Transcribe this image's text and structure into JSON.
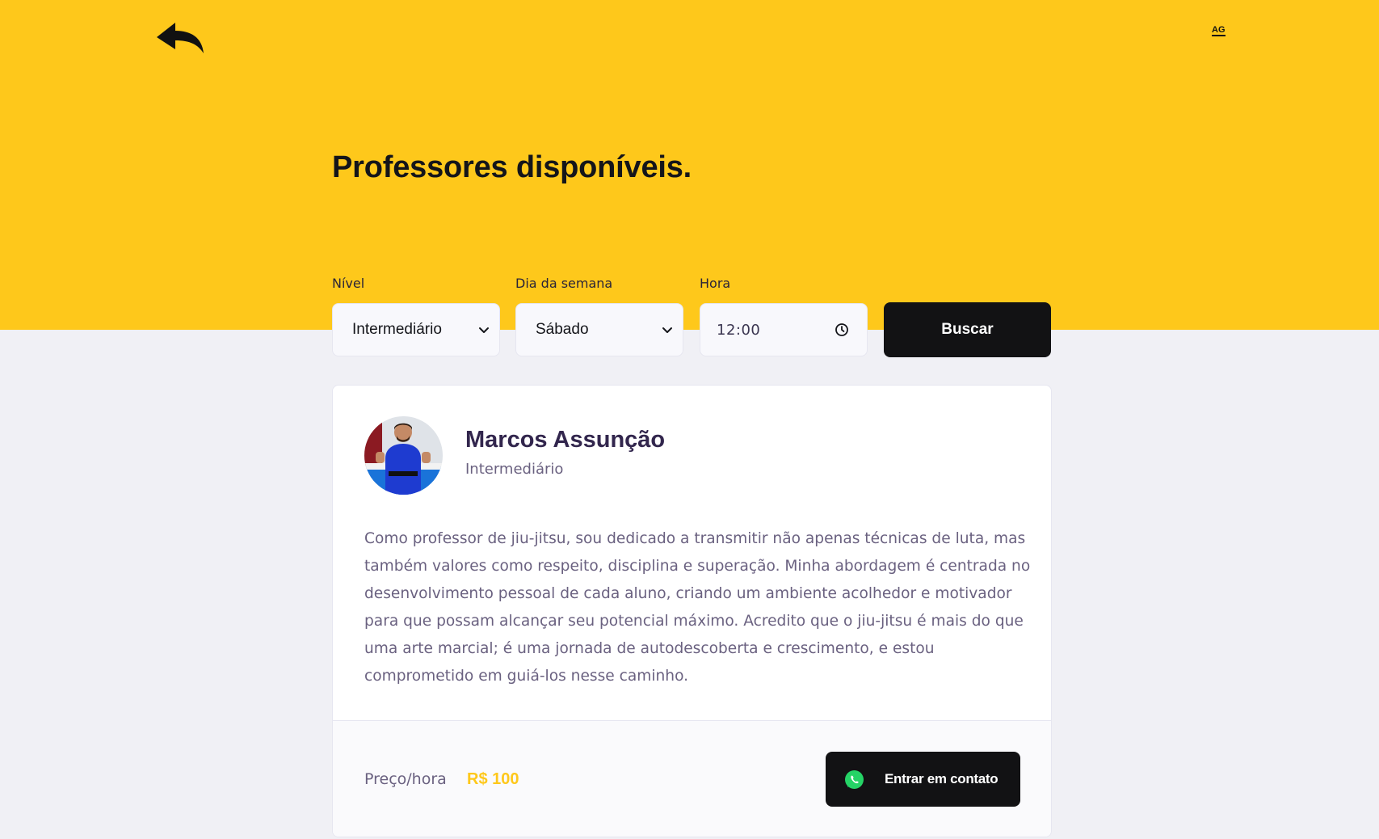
{
  "header": {
    "back_icon": "back-arrow-icon",
    "logo_text": "AG",
    "title": "Professores disponíveis."
  },
  "filters": {
    "level": {
      "label": "Nível",
      "value": "Intermediário"
    },
    "weekday": {
      "label": "Dia da semana",
      "value": "Sábado"
    },
    "time": {
      "label": "Hora",
      "value": "12:00"
    },
    "search_label": "Buscar"
  },
  "teacher": {
    "name": "Marcos Assunção",
    "level": "Intermediário",
    "bio": "Como professor de jiu-jitsu, sou dedicado a transmitir não apenas técnicas de luta, mas também valores como respeito, disciplina e superação. Minha abordagem é centrada no desenvolvimento pessoal de cada aluno, criando um ambiente acolhedor e motivador para que possam alcançar seu potencial máximo. Acredito que o jiu-jitsu é mais do que uma arte marcial; é uma jornada de autodescoberta e crescimento, e estou comprometido em guiá-los nesse caminho.",
    "price_label": "Preço/hora",
    "price_value": "R$ 100",
    "contact_label": "Entrar em contato"
  },
  "colors": {
    "accent": "#fec81b",
    "dark": "#121214",
    "background": "#f0f0f5",
    "whatsapp": "#25d366"
  }
}
